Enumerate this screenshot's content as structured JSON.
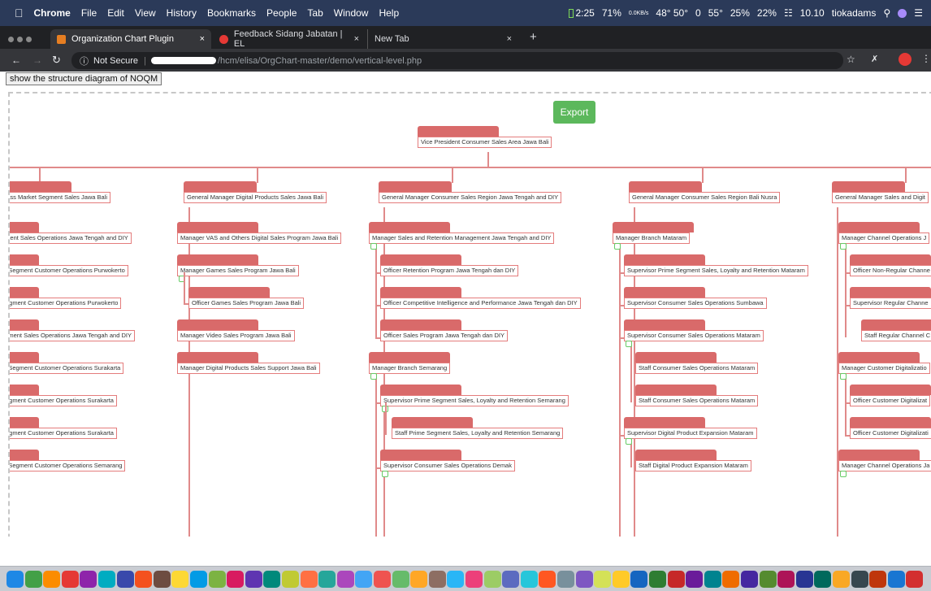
{
  "menubar": {
    "app_name": "Chrome",
    "menus": [
      "File",
      "Edit",
      "View",
      "History",
      "Bookmarks",
      "People",
      "Tab",
      "Window",
      "Help"
    ],
    "status_items": [
      "2:25",
      "71%",
      "0.0KB/s",
      "48° 50°",
      "0",
      "55°",
      "25%",
      "22%",
      "10.10",
      "tiokadams"
    ]
  },
  "tabs": [
    {
      "title": "Organization Chart Plugin",
      "close": "×",
      "active": true,
      "icon_color": "#e67e22"
    },
    {
      "title": "Feedback Sidang Jabatan | EL",
      "close": "×",
      "active": false,
      "icon_color": "#e53935"
    },
    {
      "title": "New Tab",
      "close": "×",
      "active": false
    }
  ],
  "new_tab_label": "+",
  "address": {
    "security": "Not Secure",
    "url": "/hcm/elisa/OrgChart-master/demo/vertical-level.php"
  },
  "page": {
    "structure_button": "show the structure diagram of NOQM",
    "export_button": "Export",
    "root": "Vice President Consumer Sales Area Jawa Bali",
    "columns": [
      {
        "title": "Mass Market Segment Sales Jawa Bali",
        "items": [
          "gment Sales Operations Jawa Tengah and DIY",
          "et Segment Customer Operations Purwokerto",
          "Segment Customer Operations Purwokerto",
          "egment Sales Operations Jawa Tengah and DIY",
          "et Segment Customer Operations Surakarta",
          "Segment Customer Operations Surakarta",
          "Segment Customer Operations Surakarta",
          "et Segment Customer Operations Semarang"
        ]
      },
      {
        "title": "General Manager Digital Products Sales Jawa Bali",
        "items": [
          "Manager VAS and Others Digital Sales Program Jawa Bali",
          "Manager Games Sales Program Jawa Bali",
          "Officer Games Sales Program Jawa Bali",
          "Manager Video Sales Program Jawa Bali",
          "Manager Digital Products Sales Support Jawa Bali"
        ]
      },
      {
        "title": "General Manager Consumer Sales Region Jawa Tengah and DIY",
        "items": [
          "Manager Sales and Retention Management Jawa Tengah and DIY",
          "Officer Retention Program Jawa Tengah dan DIY",
          "Officer Competitive Intelligence and Performance Jawa Tengah dan DIY",
          "Officer Sales Program Jawa Tengah dan DIY",
          "Manager Branch Semarang",
          "Supervisor Prime Segment Sales, Loyalty and Retention Semarang",
          "Staff Prime Segment Sales, Loyalty and Retention Semarang",
          "Supervisor Consumer Sales Operations Demak"
        ]
      },
      {
        "title": "General Manager Consumer Sales Region Bali Nusra",
        "items": [
          "Manager Branch Mataram",
          "Supervisor Prime Segment Sales, Loyalty and Retention Mataram",
          "Supervisor Consumer Sales Operations Sumbawa",
          "Supervisor Consumer Sales Operations Mataram",
          "Staff Consumer Sales Operations Mataram",
          "Staff Consumer Sales Operations Mataram",
          "Supervisor Digital Product Expansion Mataram",
          "Staff Digital Product Expansion Mataram"
        ]
      },
      {
        "title": "General Manager Sales and Digit",
        "items": [
          "Manager Channel Operations J",
          "Officer Non-Regular Channe",
          "Supervisor Regular Channe",
          "Staff Regular Channel C",
          "Manager Customer Digitalizatio",
          "Officer Customer Digitalizat",
          "Officer Customer Digitalizati",
          "Manager Channel Operations Ja"
        ]
      }
    ]
  },
  "dock": {
    "icon_colors": [
      "#1e88e5",
      "#43a047",
      "#fb8c00",
      "#e53935",
      "#8e24aa",
      "#00acc1",
      "#3949ab",
      "#f4511e",
      "#6d4c41",
      "#fdd835",
      "#039be5",
      "#7cb342",
      "#d81b60",
      "#5e35b1",
      "#00897b",
      "#c0ca33",
      "#ff7043",
      "#26a69a",
      "#ab47bc",
      "#42a5f5",
      "#ef5350",
      "#66bb6a",
      "#ffa726",
      "#8d6e63",
      "#29b6f6",
      "#ec407a",
      "#9ccc65",
      "#5c6bc0",
      "#26c6da",
      "#ff5722",
      "#78909c",
      "#7e57c2",
      "#d4e157",
      "#ffca28",
      "#1565c0",
      "#2e7d32",
      "#c62828",
      "#6a1b9a",
      "#00838f",
      "#ef6c00",
      "#4527a0",
      "#558b2f",
      "#ad1457",
      "#283593",
      "#00695c",
      "#f9a825",
      "#37474f",
      "#bf360c",
      "#1976d2",
      "#d32f2f"
    ]
  }
}
